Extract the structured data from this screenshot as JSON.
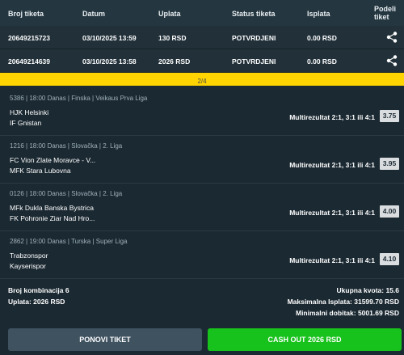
{
  "table": {
    "headers": [
      "Broj tiketa",
      "Datum",
      "Uplata",
      "Status tiketa",
      "Isplata",
      "Podeli tiket"
    ],
    "rows": [
      {
        "id": "20649215723",
        "date": "03/10/2025 13:59",
        "stake": "130 RSD",
        "status": "POTVRDJENI",
        "payout": "0.00 RSD"
      },
      {
        "id": "20649214639",
        "date": "03/10/2025 13:58",
        "stake": "2026 RSD",
        "status": "POTVRDJENI",
        "payout": "0.00 RSD"
      }
    ]
  },
  "pager": {
    "label": "2/4"
  },
  "matches": [
    {
      "code": "5386",
      "time": "18:00 Danas",
      "country": "Finska",
      "league": "Veikaus Prva Liga",
      "home": "HJK Helsinki",
      "away": "IF Gnistan",
      "market": "Multirezultat 2:1, 3:1 ili 4:1",
      "odd": "3.75"
    },
    {
      "code": "1216",
      "time": "18:00 Danas",
      "country": "Slovačka",
      "league": "2. Liga",
      "home": "FC Vion Zlate Moravce - V...",
      "away": "MFK Stara Lubovna",
      "market": "Multirezultat 2:1, 3:1 ili 4:1",
      "odd": "3.95"
    },
    {
      "code": "0126",
      "time": "18:00 Danas",
      "country": "Slovačka",
      "league": "2. Liga",
      "home": "MFk Dukla Banska Bystrica",
      "away": "FK Pohronie Ziar Nad Hro...",
      "market": "Multirezultat 2:1, 3:1 ili 4:1",
      "odd": "4.00"
    },
    {
      "code": "2862",
      "time": "19:00 Danas",
      "country": "Turska",
      "league": "Super Liga",
      "home": "Trabzonspor",
      "away": "Kayserispor",
      "market": "Multirezultat 2:1, 3:1 ili 4:1",
      "odd": "4.10"
    }
  ],
  "summary": {
    "combinations": "Broj kombinacija 6",
    "stake": "Uplata: 2026 RSD",
    "total_odds": "Ukupna kvota: 15.6",
    "max_payout": "Maksimalna Isplata: 31599.70 RSD",
    "min_win": "Minimalni dobitak: 5001.69 RSD"
  },
  "buttons": {
    "repeat": "PONOVI TIKET",
    "cashout": "CASH OUT 2026 RSD"
  },
  "icons": {
    "share": "share-icon"
  },
  "colors": {
    "accent_yellow": "#ffd400",
    "cashout_green": "#18c21c",
    "background": "#1b2932"
  }
}
